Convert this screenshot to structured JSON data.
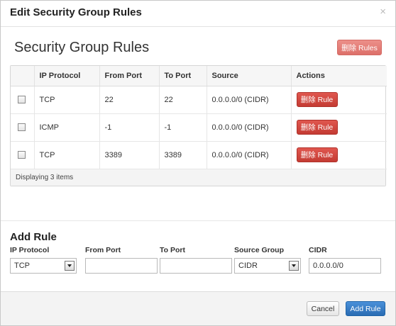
{
  "modal": {
    "title": "Edit Security Group Rules",
    "close_glyph": "×"
  },
  "rules_section": {
    "title": "Security Group Rules",
    "delete_rules_label": "删除 Rules"
  },
  "table": {
    "headers": [
      "",
      "IP Protocol",
      "From Port",
      "To Port",
      "Source",
      "Actions"
    ],
    "rows": [
      {
        "protocol": "TCP",
        "from_port": "22",
        "to_port": "22",
        "source": "0.0.0.0/0 (CIDR)",
        "action_label": "删除 Rule",
        "checked": false
      },
      {
        "protocol": "ICMP",
        "from_port": "-1",
        "to_port": "-1",
        "source": "0.0.0.0/0 (CIDR)",
        "action_label": "删除 Rule",
        "checked": false
      },
      {
        "protocol": "TCP",
        "from_port": "3389",
        "to_port": "3389",
        "source": "0.0.0.0/0 (CIDR)",
        "action_label": "删除 Rule",
        "checked": false
      }
    ],
    "footer": "Displaying 3 items"
  },
  "add_rule": {
    "title": "Add Rule",
    "ip_protocol": {
      "label": "IP Protocol",
      "value": "TCP"
    },
    "from_port": {
      "label": "From Port",
      "value": ""
    },
    "to_port": {
      "label": "To Port",
      "value": ""
    },
    "source_group": {
      "label": "Source Group",
      "value": "CIDR"
    },
    "cidr": {
      "label": "CIDR",
      "value": "0.0.0.0/0"
    }
  },
  "footer": {
    "cancel_label": "Cancel",
    "add_label": "Add Rule"
  },
  "colors": {
    "danger": "#c9423a",
    "primary": "#2f75c0"
  },
  "icons": [
    "close-icon",
    "checkbox-icon",
    "chevron-down-icon"
  ]
}
